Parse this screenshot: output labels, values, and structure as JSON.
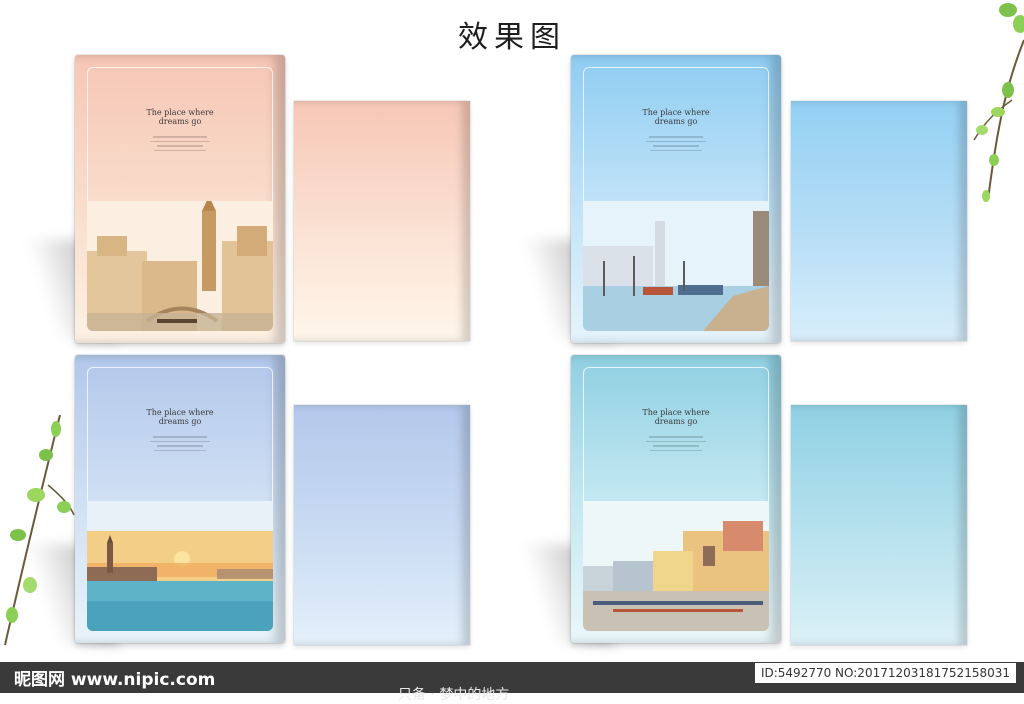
{
  "title": "效果图",
  "cover_tagline": "The place where\ndreams go",
  "watermark": {
    "site": "昵图网 www.nipic.com",
    "id_text": "ID:5492770 NO:20171203181752158031",
    "name": "只备 · 梦中的地方"
  },
  "colors": {
    "peach": "#f6cbbb",
    "sky": "#9fd3f2",
    "periwinkle": "#b6c9ea",
    "aqua": "#98d3e4"
  },
  "icons": [
    "branch-leaves-icon"
  ]
}
